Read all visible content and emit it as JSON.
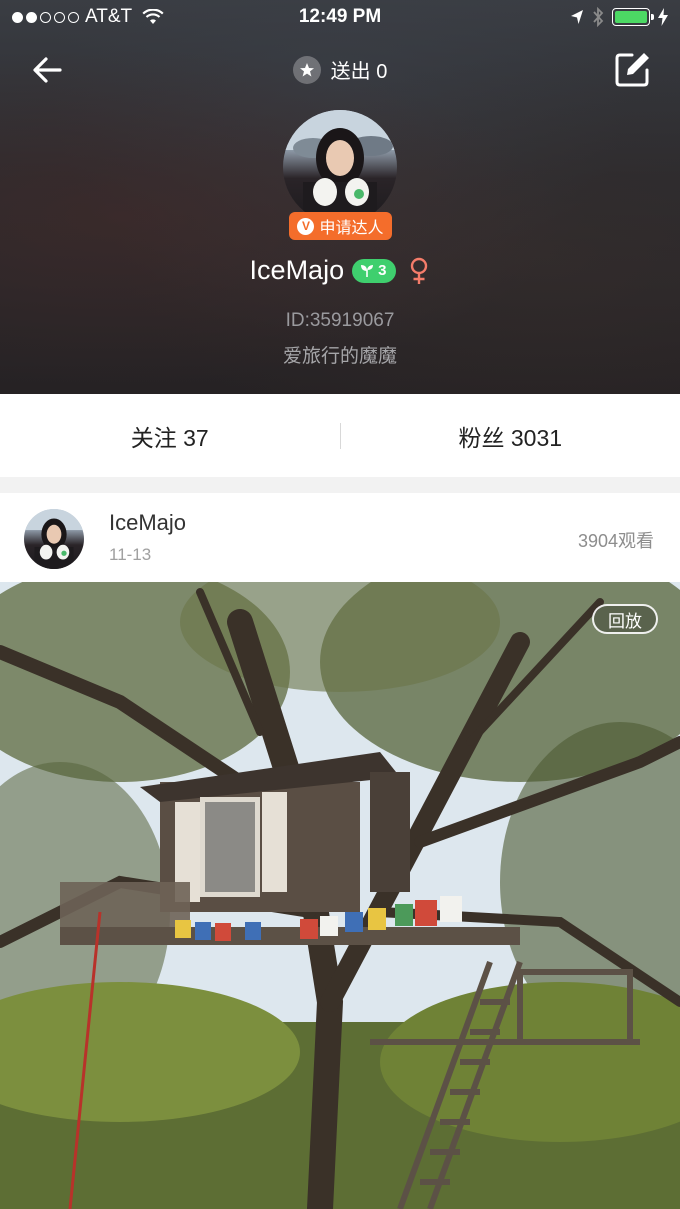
{
  "status_bar": {
    "carrier": "AT&T",
    "time": "12:49 PM",
    "signal_bars_filled": 2,
    "signal_bars_total": 5,
    "battery_level": 1.0,
    "battery_color": "#4cd964"
  },
  "nav": {
    "back_icon": "arrow-left-icon",
    "sent_label": "送出 0",
    "star_icon": "star-icon",
    "edit_icon": "edit-icon"
  },
  "profile": {
    "apply_badge_label": "申请达人",
    "apply_badge_icon": "v-icon",
    "apply_badge_color": "#f46d2b",
    "username": "IceMajo",
    "level": "3",
    "level_badge_color": "#3fcf6e",
    "gender_icon": "female-icon",
    "user_id": "ID:35919067",
    "bio": "爱旅行的魔魔"
  },
  "stats": {
    "following": "关注 37",
    "followers": "粉丝 3031"
  },
  "post": {
    "username": "IceMajo",
    "date": "11-13",
    "views": "3904观看",
    "replay_label": "回放"
  }
}
